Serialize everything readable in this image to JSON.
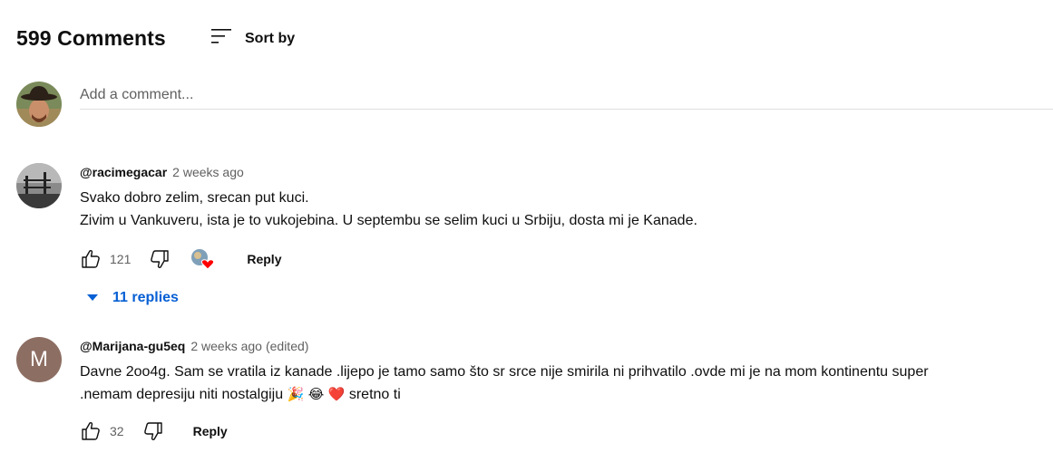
{
  "header": {
    "comment_count": "599 Comments",
    "sort_label": "Sort by"
  },
  "add_comment": {
    "placeholder": "Add a comment..."
  },
  "comments": [
    {
      "author": "@racimegacar",
      "time": "2 weeks ago",
      "lines": [
        "Svako dobro zelim, srecan put kuci.",
        "Zivim u Vankuveru, ista je to vukojebina. U septembu se selim kuci u Srbiju, dosta mi je Kanade."
      ],
      "likes": "121",
      "reply_label": "Reply",
      "replies_label": "11 replies"
    },
    {
      "author": "@Marijana-gu5eq",
      "time": "2 weeks ago",
      "edited": "(edited)",
      "avatar_letter": "M",
      "avatar_color": "#8d6e63",
      "lines": [
        "Davne 2oo4g. Sam se vratila iz kanade .lijepo je tamo samo što sr srce nije smirila ni prihvatilo .ovde mi je na mom kontinentu super",
        ".nemam depresiju niti nostalgiju"
      ],
      "emojis": [
        "🎉",
        "😂",
        "❤️"
      ],
      "trailing_text": "sretno ti",
      "likes": "32",
      "reply_label": "Reply"
    }
  ],
  "colors": {
    "link_blue": "#065fd4",
    "heart_red": "#ff0000",
    "secondary_text": "#606060"
  }
}
